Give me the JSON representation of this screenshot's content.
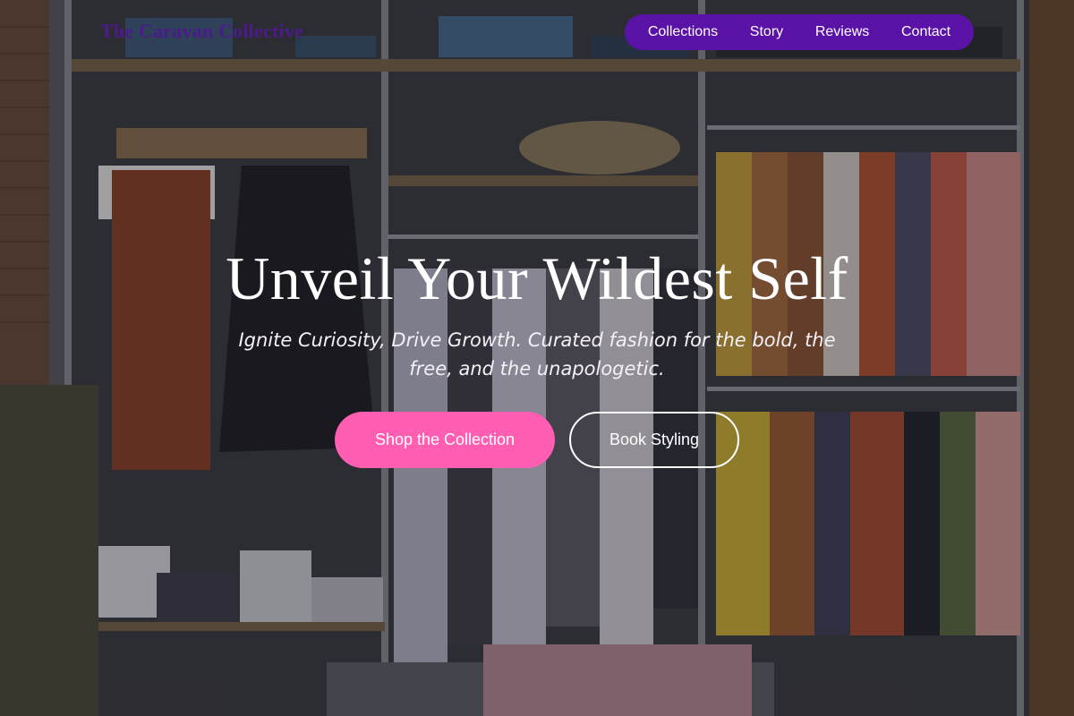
{
  "brand": {
    "name": "The Caravan Collective"
  },
  "nav": {
    "items": [
      {
        "label": "Collections"
      },
      {
        "label": "Story"
      },
      {
        "label": "Reviews"
      },
      {
        "label": "Contact"
      }
    ]
  },
  "hero": {
    "title": "Unveil Your Wildest Self",
    "subtitle": "Ignite Curiosity, Drive Growth. Curated fashion for the bold, the free, and the unapologetic.",
    "primary_cta": "Shop the Collection",
    "secondary_cta": "Book Styling"
  },
  "colors": {
    "nav_background": "#5a13a6",
    "brand_text": "#4b1a8c",
    "primary_button": "#ff5eb3"
  }
}
